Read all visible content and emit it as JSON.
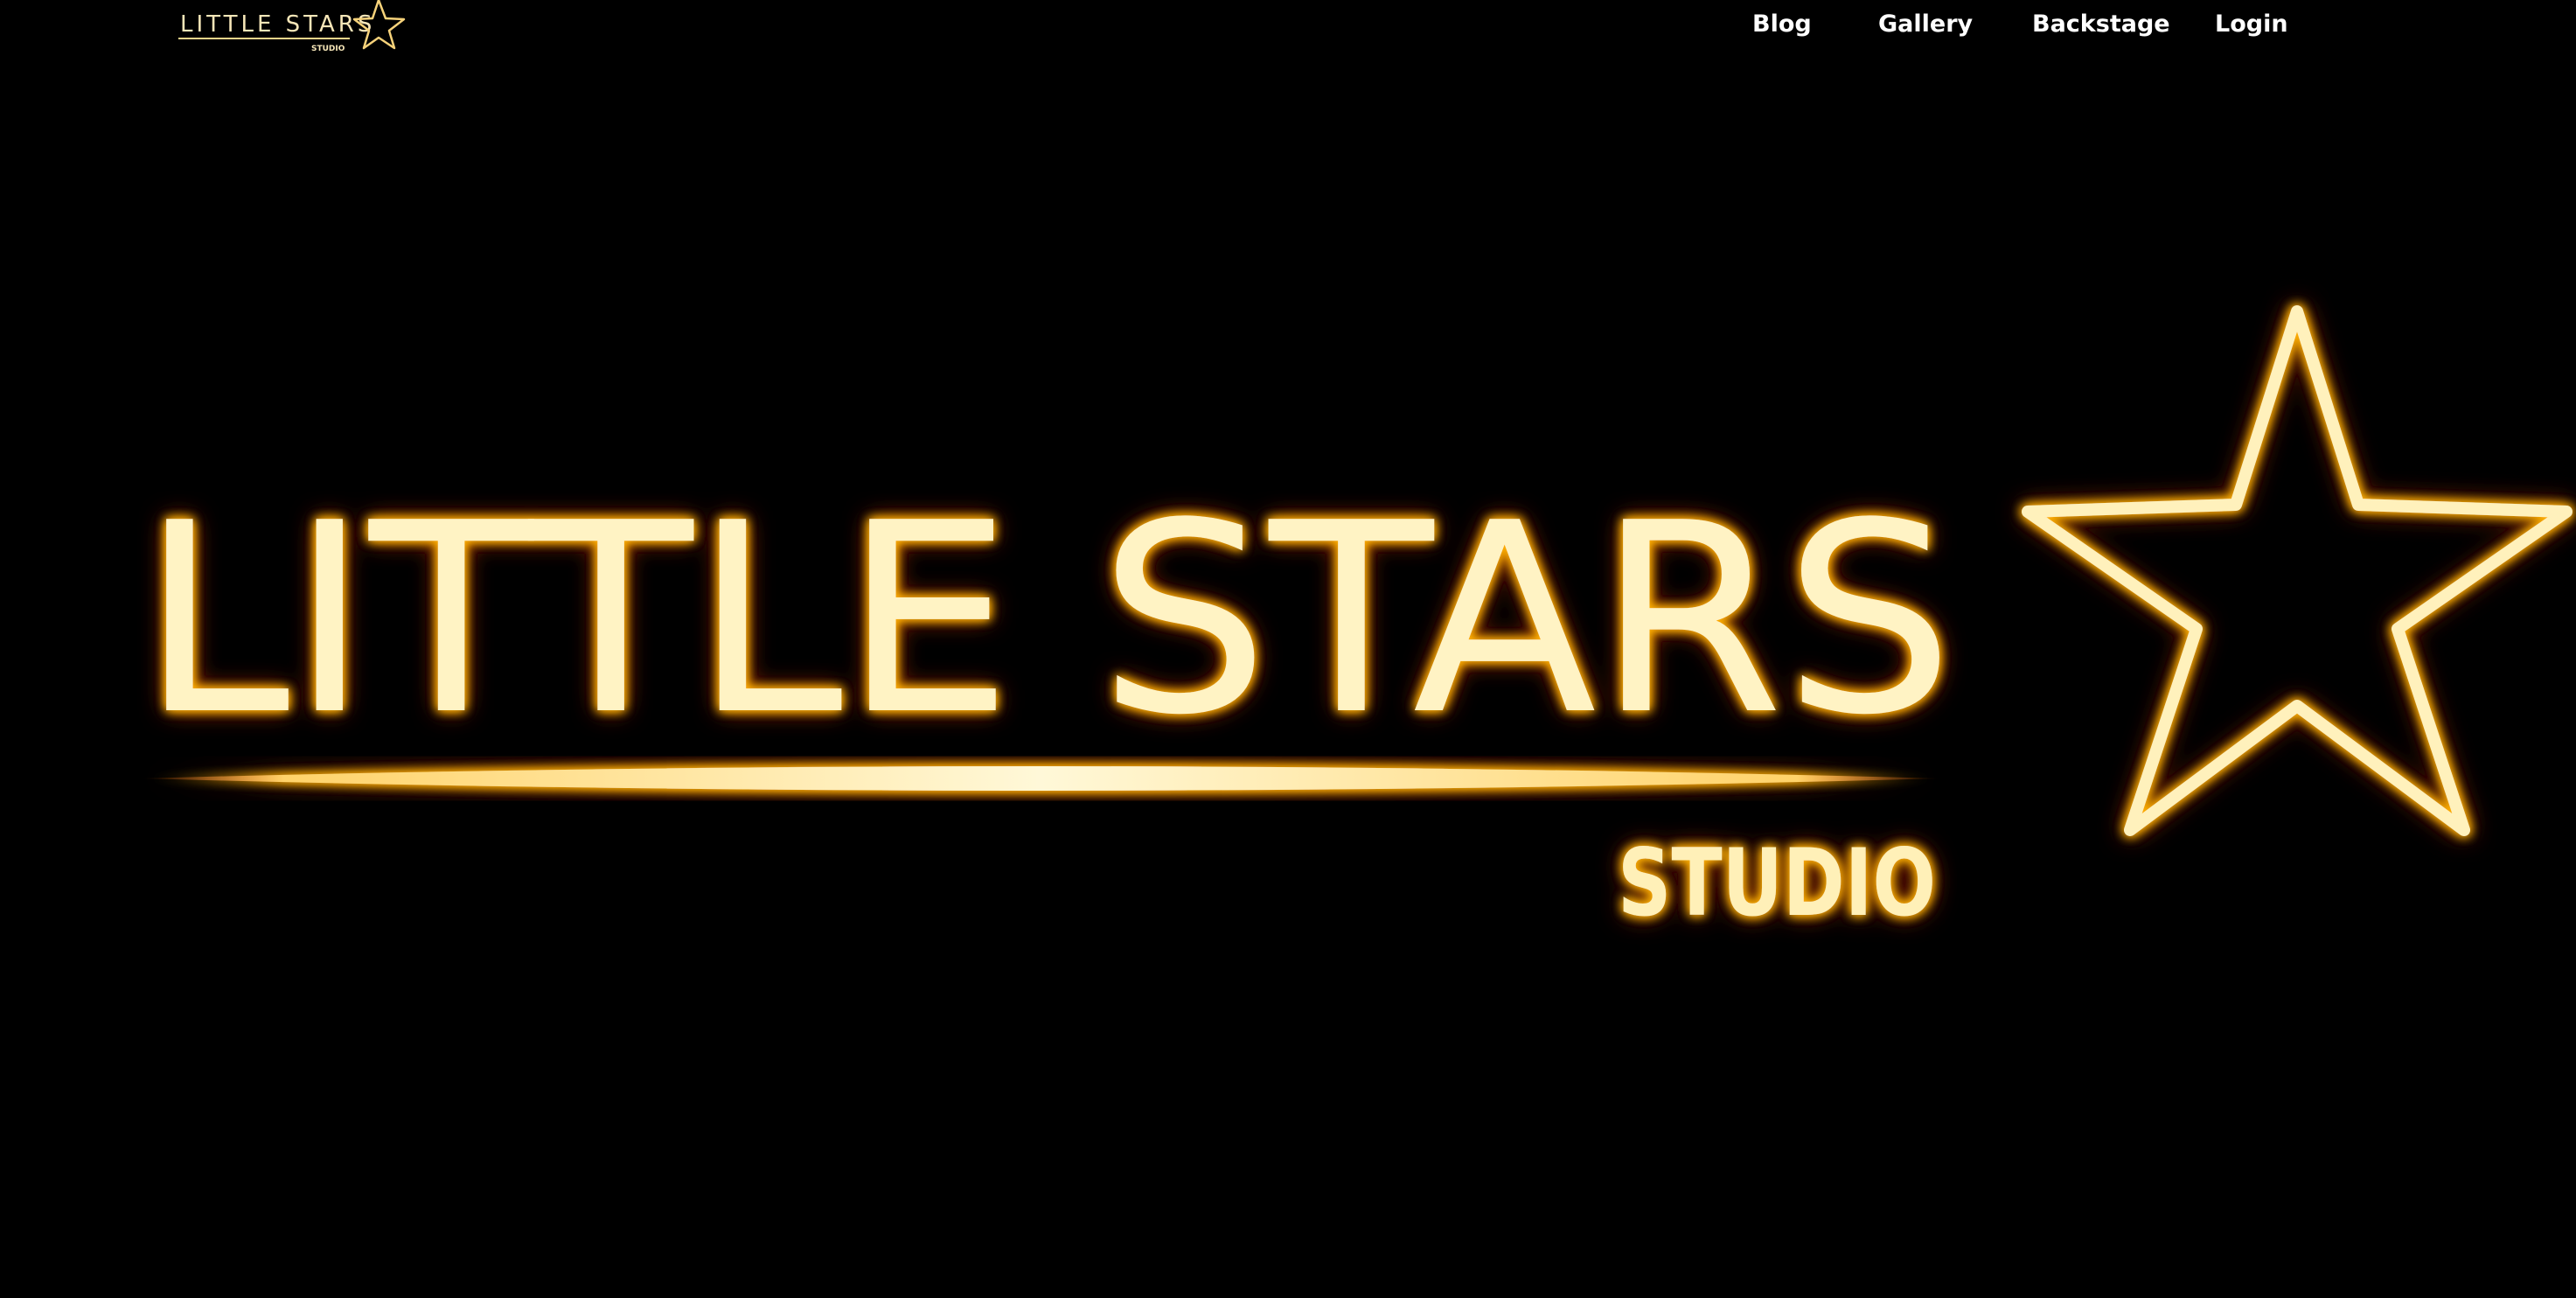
{
  "header": {
    "logo": {
      "text": "LITTLE STARS",
      "subtext": "STUDIO",
      "icon": "star-outline-icon"
    },
    "nav": [
      {
        "label": "Blog"
      },
      {
        "label": "Gallery"
      },
      {
        "label": "Backstage"
      },
      {
        "label": "Login"
      }
    ]
  },
  "hero": {
    "logo_text": "LITTLE STARS",
    "logo_subtext": "STUDIO",
    "icon": "neon-star-icon"
  },
  "colors": {
    "background": "#000000",
    "nav_text": "#ffffff",
    "neon_core": "#fff6c8",
    "neon_glow": "#ffb000",
    "neon_edge": "#e23a00"
  }
}
